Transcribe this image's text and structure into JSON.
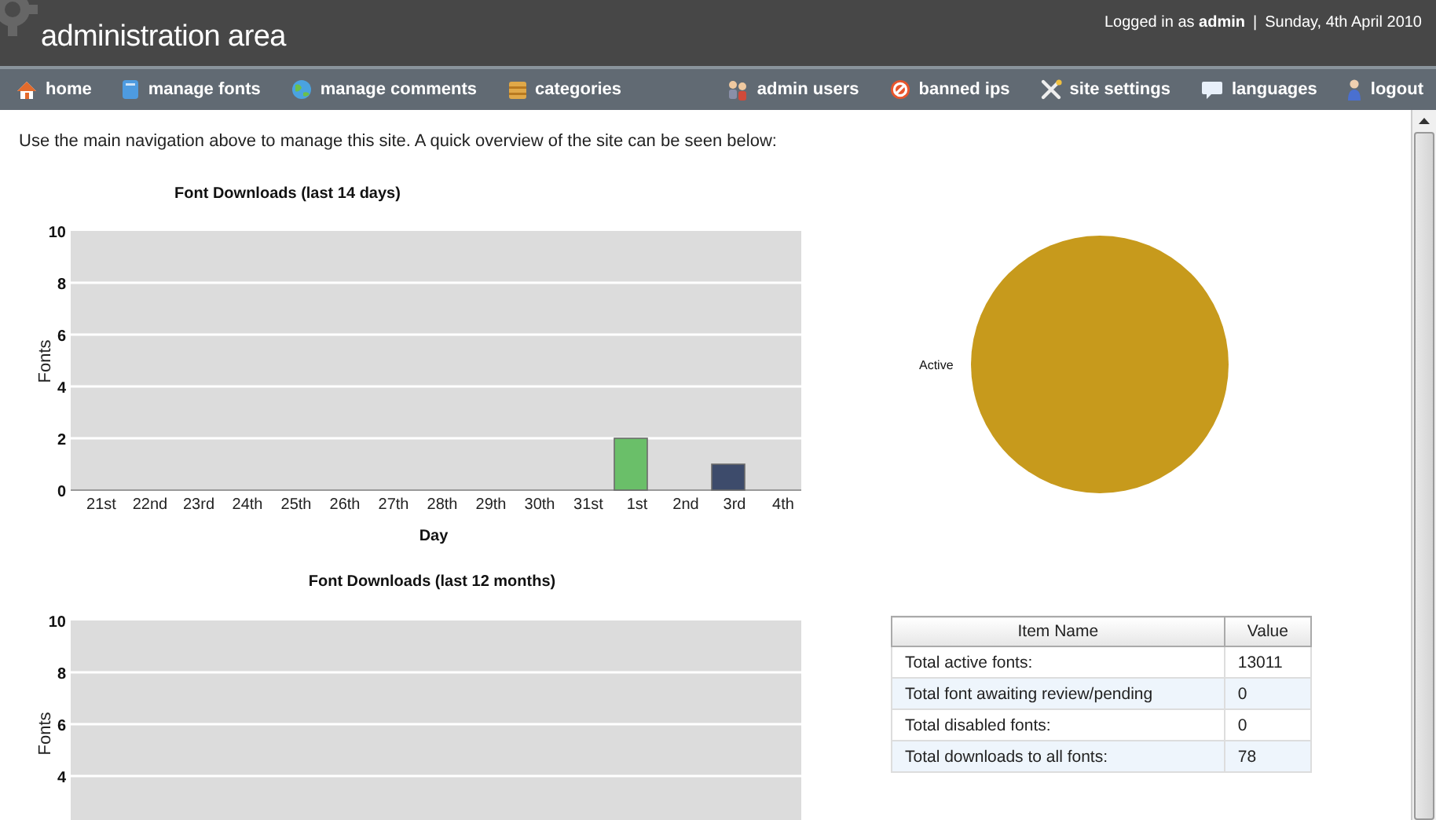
{
  "header": {
    "title": "administration area",
    "user_info": "Logged in as **admin**",
    "separator": "|",
    "date": "Sunday, 4th April 2010"
  },
  "nav_left": [
    {
      "label": "home"
    },
    {
      "label": "manage fonts"
    },
    {
      "label": "manage comments"
    },
    {
      "label": "categories"
    }
  ],
  "nav_right": [
    {
      "label": "admin users"
    },
    {
      "label": "banned ips"
    },
    {
      "label": "site settings"
    },
    {
      "label": "languages"
    },
    {
      "label": "logout"
    }
  ],
  "intro": "Use the main navigation above to manage this site. A quick overview of the site can be seen below:",
  "daily_chart": {
    "chart_data": {
      "type": "bar",
      "title": "Font Downloads (last 14 days)",
      "xlabel": "Day",
      "ylabel": "Fonts",
      "categories": [
        "21st",
        "22nd",
        "23rd",
        "24th",
        "25th",
        "26th",
        "27th",
        "28th",
        "29th",
        "30th",
        "31st",
        "1st",
        "2nd",
        "3rd",
        "4th"
      ],
      "values": [
        0,
        0,
        0,
        0,
        0,
        0,
        0,
        0,
        0,
        0,
        0,
        2,
        0,
        1,
        0
      ],
      "colors": [
        "#6abf69",
        "#6abf69",
        "#6abf69",
        "#6abf69",
        "#6abf69",
        "#6abf69",
        "#6abf69",
        "#6abf69",
        "#6abf69",
        "#6abf69",
        "#6abf69",
        "#6abf69",
        "#6abf69",
        "#3d4b6b",
        "#3d4b6b"
      ],
      "ylim": [
        0,
        10
      ],
      "yticks": [
        0,
        2,
        4,
        6,
        8,
        10
      ],
      "grid": true
    }
  },
  "status_chart": {
    "chart_data": {
      "type": "pie",
      "categories": [
        "Active"
      ],
      "values": [
        100
      ],
      "colors": [
        "#c79a1c"
      ]
    }
  },
  "monthly_chart": {
    "chart_data": {
      "type": "bar",
      "title": "Font Downloads (last 12 months)",
      "ylabel": "Fonts",
      "categories": [
        null,
        null,
        null,
        null,
        null,
        null,
        null,
        null,
        null,
        null,
        null,
        null
      ],
      "values": [
        null,
        null,
        null,
        null,
        null,
        null,
        null,
        null,
        null,
        null,
        null,
        null
      ],
      "ylim": [
        0,
        10
      ],
      "yticks": [
        4,
        6,
        8,
        10
      ],
      "grid": true
    }
  },
  "stats_table": {
    "columns": [
      "Item Name",
      "Value"
    ],
    "rows": [
      [
        "Total active fonts:",
        "13011"
      ],
      [
        "Total font awaiting review/pending",
        "0"
      ],
      [
        "Total disabled fonts:",
        "0"
      ],
      [
        "Total downloads to all fonts:",
        "78"
      ]
    ]
  }
}
